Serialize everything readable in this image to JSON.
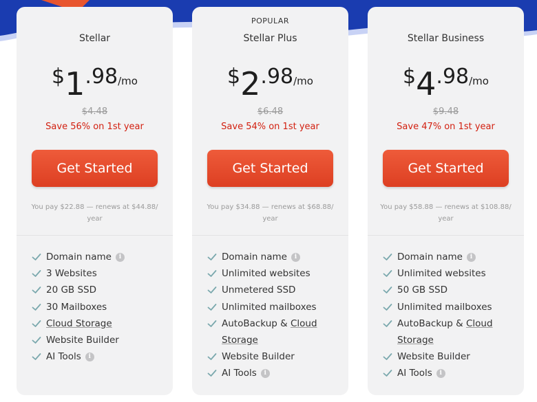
{
  "colors": {
    "accent": "#e44a2c",
    "save_red": "#d21f0f",
    "card_bg": "#f2f2f3",
    "banner_blue": "#1a3cb0",
    "check_teal": "#7aa8ad"
  },
  "plans": [
    {
      "badge": "",
      "name": "Stellar",
      "currency": "$",
      "dollars": "1",
      "cents": ".98",
      "per": "/mo",
      "original_price": "$4.48",
      "save_text": "Save 56% on 1st year",
      "cta_label": "Get Started",
      "renew_text": "You pay $22.88 — renews at $44.88/ year",
      "features": [
        {
          "parts": [
            {
              "text": "Domain name",
              "link": false
            }
          ],
          "info": true
        },
        {
          "parts": [
            {
              "text": "3 Websites",
              "link": false
            }
          ],
          "info": false
        },
        {
          "parts": [
            {
              "text": "20 GB SSD",
              "link": false
            }
          ],
          "info": false
        },
        {
          "parts": [
            {
              "text": "30 Mailboxes",
              "link": false
            }
          ],
          "info": false
        },
        {
          "parts": [
            {
              "text": "Cloud Storage",
              "link": true
            }
          ],
          "info": false
        },
        {
          "parts": [
            {
              "text": "Website Builder",
              "link": false
            }
          ],
          "info": false
        },
        {
          "parts": [
            {
              "text": "AI Tools",
              "link": false
            }
          ],
          "info": true
        }
      ]
    },
    {
      "badge": "POPULAR",
      "name": "Stellar Plus",
      "currency": "$",
      "dollars": "2",
      "cents": ".98",
      "per": "/mo",
      "original_price": "$6.48",
      "save_text": "Save 54% on 1st year",
      "cta_label": "Get Started",
      "renew_text": "You pay $34.88 — renews at $68.88/ year",
      "features": [
        {
          "parts": [
            {
              "text": "Domain name",
              "link": false
            }
          ],
          "info": true
        },
        {
          "parts": [
            {
              "text": "Unlimited websites",
              "link": false
            }
          ],
          "info": false
        },
        {
          "parts": [
            {
              "text": "Unmetered SSD",
              "link": false
            }
          ],
          "info": false
        },
        {
          "parts": [
            {
              "text": "Unlimited mailboxes",
              "link": false
            }
          ],
          "info": false
        },
        {
          "parts": [
            {
              "text": "AutoBackup & ",
              "link": false
            },
            {
              "text": "Cloud Storage",
              "link": true
            }
          ],
          "info": false
        },
        {
          "parts": [
            {
              "text": "Website Builder",
              "link": false
            }
          ],
          "info": false
        },
        {
          "parts": [
            {
              "text": "AI Tools",
              "link": false
            }
          ],
          "info": true
        }
      ]
    },
    {
      "badge": "",
      "name": "Stellar Business",
      "currency": "$",
      "dollars": "4",
      "cents": ".98",
      "per": "/mo",
      "original_price": "$9.48",
      "save_text": "Save 47% on 1st year",
      "cta_label": "Get Started",
      "renew_text": "You pay $58.88 — renews at $108.88/ year",
      "features": [
        {
          "parts": [
            {
              "text": "Domain name",
              "link": false
            }
          ],
          "info": true
        },
        {
          "parts": [
            {
              "text": "Unlimited websites",
              "link": false
            }
          ],
          "info": false
        },
        {
          "parts": [
            {
              "text": "50 GB SSD",
              "link": false
            }
          ],
          "info": false
        },
        {
          "parts": [
            {
              "text": "Unlimited mailboxes",
              "link": false
            }
          ],
          "info": false
        },
        {
          "parts": [
            {
              "text": "AutoBackup & ",
              "link": false
            },
            {
              "text": "Cloud Storage",
              "link": true
            }
          ],
          "info": false
        },
        {
          "parts": [
            {
              "text": "Website Builder",
              "link": false
            }
          ],
          "info": false
        },
        {
          "parts": [
            {
              "text": "AI Tools",
              "link": false
            }
          ],
          "info": true
        }
      ]
    }
  ]
}
